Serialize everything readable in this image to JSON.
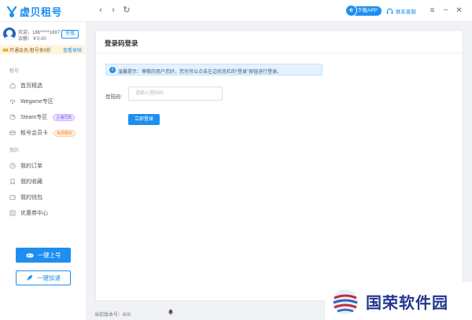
{
  "app": {
    "title": "虚贝租号"
  },
  "titlebar": {
    "download_label": "下载APP",
    "customer_service_label": "联系客服"
  },
  "user": {
    "greeting": "欢迎，186*****1697",
    "balance": "余额：￥0.00",
    "recharge_label": "充值"
  },
  "vip_bar": {
    "text": "开通会员,租号享9折",
    "link_label": "查看体验"
  },
  "sidebar": {
    "section_rent": "租号",
    "items_rent": [
      {
        "label": "首页精选"
      },
      {
        "label": "Wegame专区"
      },
      {
        "label": "Steam专区",
        "badge": "主播同款"
      },
      {
        "label": "租号会员卡",
        "badge": "免费畅玩"
      }
    ],
    "section_mine": "我的",
    "items_mine": [
      {
        "label": "我的订单"
      },
      {
        "label": "我的收藏"
      },
      {
        "label": "我的钱包"
      },
      {
        "label": "优惠券中心"
      }
    ],
    "one_click_login_label": "一键上号",
    "one_click_accel_label": "一键加速",
    "version": "当前版本号：600"
  },
  "main": {
    "title": "登录码登录",
    "notice": "温馨提示：尊敬的用户您好，您也可以点击左边状态栏的“登录”按钮进行登录。",
    "field_label": "登陆码:",
    "field_placeholder": "请输入登陆码",
    "submit_label": "立即登录"
  },
  "watermark": {
    "text": "国荣软件园"
  },
  "colors": {
    "accent": "#1e8ef0",
    "vip_bg": "#fff4de",
    "notice_bg": "#e4f2ff"
  }
}
